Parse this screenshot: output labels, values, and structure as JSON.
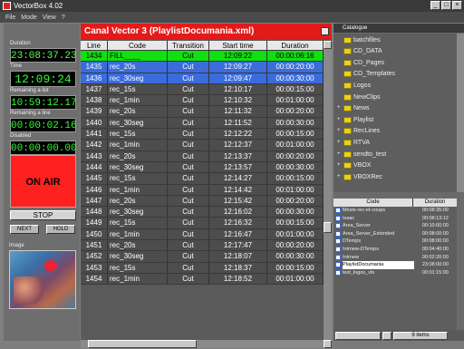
{
  "window": {
    "title": "VectorBox 4.02",
    "controls": [
      "_",
      "□",
      "×"
    ]
  },
  "menu": [
    "File",
    "Mode",
    "View",
    "?"
  ],
  "left": {
    "duration_label": "Duration",
    "duration": "23:08:37.23",
    "time_label": "Time",
    "time": "12:09:24",
    "remaining_label": "Remaining a list",
    "remaining": "10:59:12.17",
    "remaining_file_label": "Remaining a line",
    "remaining_file": "00:00:02.16",
    "disabled_label": "Disabled",
    "disabled": "00:00:00.00",
    "onair": "ON AIR",
    "stop": "STOP",
    "next": "NEXT",
    "hold": "HOLD",
    "image_label": "Image"
  },
  "main": {
    "title": "Canal Vector 3  (PlaylistDocumania.xml)",
    "columns": [
      "Line",
      "Code",
      "Transition",
      "Start time",
      "Duration"
    ],
    "rows": [
      [
        "1434",
        "FILL____",
        "Cut",
        "12:09:22",
        "00:00:06:16"
      ],
      [
        "1435",
        "rec_20s",
        "Cut",
        "12:09:27",
        "00:00:20:00"
      ],
      [
        "1436",
        "rec_30seg",
        "Cut",
        "12:09:47",
        "00:00:30:00"
      ],
      [
        "1437",
        "rec_15s",
        "Cut",
        "12:10:17",
        "00:00:15:00"
      ],
      [
        "1438",
        "rec_1min",
        "Cut",
        "12:10:32",
        "00:01:00:00"
      ],
      [
        "1439",
        "rec_20s",
        "Cut",
        "12:11:32",
        "00:00:20:00"
      ],
      [
        "1440",
        "rec_30seg",
        "Cut",
        "12:11:52",
        "00:00:30:00"
      ],
      [
        "1441",
        "rec_15s",
        "Cut",
        "12:12:22",
        "00:00:15:00"
      ],
      [
        "1442",
        "rec_1min",
        "Cut",
        "12:12:37",
        "00:01:00:00"
      ],
      [
        "1443",
        "rec_20s",
        "Cut",
        "12:13:37",
        "00:00:20:00"
      ],
      [
        "1444",
        "rec_30seg",
        "Cut",
        "12:13:57",
        "00:00:30:00"
      ],
      [
        "1445",
        "rec_15s",
        "Cut",
        "12:14:27",
        "00:00:15:00"
      ],
      [
        "1446",
        "rec_1min",
        "Cut",
        "12:14:42",
        "00:01:00:00"
      ],
      [
        "1447",
        "rec_20s",
        "Cut",
        "12:15:42",
        "00:00:20:00"
      ],
      [
        "1448",
        "rec_30seg",
        "Cut",
        "12:16:02",
        "00:00:30:00"
      ],
      [
        "1449",
        "rec_15s",
        "Cut",
        "12:16:32",
        "00:00:15:00"
      ],
      [
        "1450",
        "rec_1min",
        "Cut",
        "12:16:47",
        "00:01:00:00"
      ],
      [
        "1451",
        "rec_20s",
        "Cut",
        "12:17:47",
        "00:00:20:00"
      ],
      [
        "1452",
        "rec_30seg",
        "Cut",
        "12:18:07",
        "00:00:30:00"
      ],
      [
        "1453",
        "rec_15s",
        "Cut",
        "12:18:37",
        "00:00:15:00"
      ],
      [
        "1454",
        "rec_1min",
        "Cut",
        "12:18:52",
        "00:01:00:00"
      ]
    ]
  },
  "catalogue": {
    "title": "Catalogue",
    "folders": [
      "batchfiles",
      "CD_DATA",
      "CD_Pages",
      "CD_Templates",
      "Logos",
      "NewClips",
      "News",
      "Playlist",
      "RecLines",
      "RTVA",
      "sendto_test",
      "VBOX",
      "VBOXRec"
    ],
    "list_columns": [
      "Code",
      "Duration"
    ],
    "items": [
      [
        "Movie-rec-et-coups",
        "00:08:35:00"
      ],
      [
        "Isaac",
        "00:08:13:12"
      ],
      [
        "Area_Server",
        "00:10:00:00"
      ],
      [
        "Area_Server_Extended",
        "00:08:00:00"
      ],
      [
        "DTemps",
        "00:08:00:00"
      ],
      [
        "Intrnew-DTemps",
        "00:04:40:00"
      ],
      [
        "Intrnew",
        "00:02:20:00"
      ],
      [
        "PlaylistDocumania",
        "23:08:00:00"
      ],
      [
        "test_logos_vts",
        "00:01:15:00"
      ]
    ],
    "items_count": "9 items"
  }
}
